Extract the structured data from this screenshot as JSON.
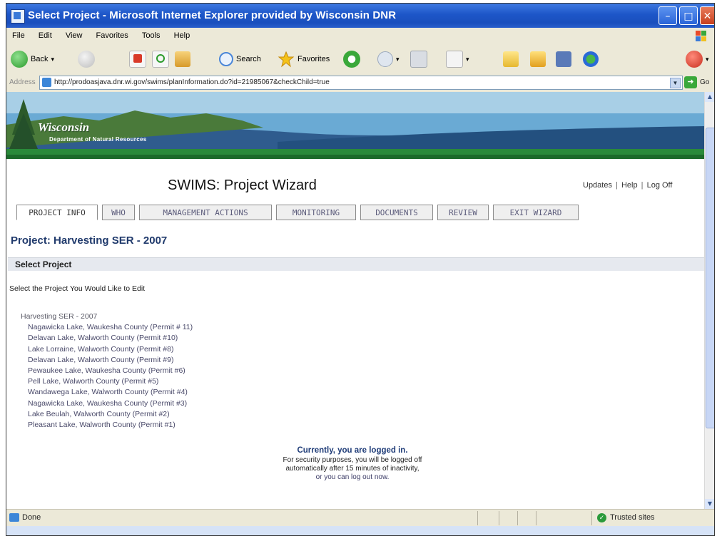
{
  "window": {
    "title": "Select Project - Microsoft Internet Explorer provided by Wisconsin DNR"
  },
  "menu": [
    "File",
    "Edit",
    "View",
    "Favorites",
    "Tools",
    "Help"
  ],
  "toolbar": {
    "back_label": "Back",
    "search_label": "Search",
    "favorites_label": "Favorites"
  },
  "address": {
    "label": "Address",
    "url": "http://prodoasjava.dnr.wi.gov/swims/planInformation.do?id=21985067&checkChild=true",
    "go_label": "Go"
  },
  "banner": {
    "line1": "Wisconsin",
    "line2": "Department of Natural Resources"
  },
  "app": {
    "title": "SWIMS: Project Wizard",
    "links": [
      "Updates",
      "Help",
      "Log Off"
    ]
  },
  "tabs": [
    "PROJECT INFO",
    "WHO",
    "MANAGEMENT ACTIONS",
    "MONITORING",
    "DOCUMENTS",
    "REVIEW",
    "EXIT WIZARD"
  ],
  "project": {
    "heading": "Project: Harvesting SER - 2007",
    "section_title": "Select Project",
    "instruction": "Select the Project You Would Like to Edit",
    "parent": "Harvesting SER - 2007",
    "children": [
      "Nagawicka Lake, Waukesha County (Permit # 11)",
      "Delavan Lake, Walworth County (Permit #10)",
      "Lake Lorraine, Walworth County (Permit #8)",
      "Delavan Lake, Walworth County (Permit #9)",
      "Pewaukee Lake, Waukesha County (Permit #6)",
      "Pell Lake, Walworth County (Permit #5)",
      "Wandawega Lake, Walworth County (Permit #4)",
      "Nagawicka Lake, Waukesha County (Permit #3)",
      "Lake Beulah, Walworth County (Permit #2)",
      "Pleasant Lake, Walworth County (Permit #1)"
    ]
  },
  "login": {
    "headline": "Currently, you are logged in.",
    "line1": "For security purposes, you will be logged off",
    "line2": "automatically after 15 minutes of inactivity,",
    "line3": "or you can log out now."
  },
  "status": {
    "text": "Done",
    "zone": "Trusted sites"
  },
  "colors": {
    "titlebar": "#1d56c8",
    "tab_text": "#5a5a7a",
    "heading": "#203a6c",
    "link": "#4a4a6a"
  }
}
